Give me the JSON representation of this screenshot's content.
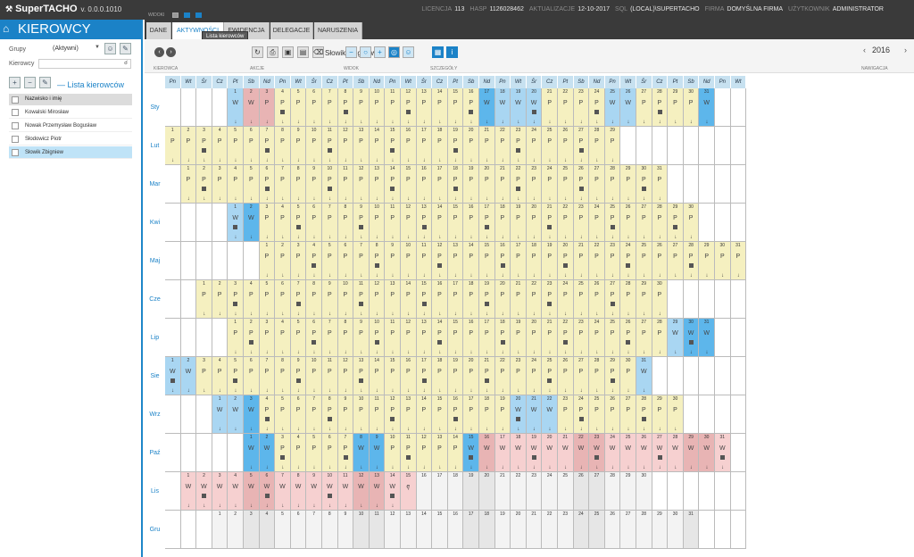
{
  "app": {
    "name": "SuperTACHO",
    "version": "v. 0.0.0.1010",
    "widok_label": "WIDOKI"
  },
  "status": [
    {
      "label": "LICENCJA",
      "value": "113"
    },
    {
      "label": "HASP",
      "value": "1126028462"
    },
    {
      "label": "AKTUALIZACJE",
      "value": "12-10-2017"
    },
    {
      "label": "SQL",
      "value": "(LOCAL)\\SUPERTACHO"
    },
    {
      "label": "FIRMA",
      "value": "DOMYŚLNA FIRMA"
    },
    {
      "label": "UŻYTKOWNIK",
      "value": "ADMINISTRATOR"
    }
  ],
  "left": {
    "title": "KIEROWCY",
    "groups_label": "Grupy",
    "groups_value": "(Aktywni)",
    "drivers_label": "Kierowcy",
    "list_title": "Lista kierowców",
    "column_header": "Nazwisko i imię",
    "drivers": [
      "Kowalski Mirosław",
      "Nowak Przemysław Bogusław",
      "Słodowicz Piotr",
      "Słowik Zbigniew"
    ],
    "selected_index": 3
  },
  "tabs": [
    "DANE",
    "AKTYWNOŚCI",
    "EWIDENCJA",
    "DELEGACJE",
    "NARUSZENIA"
  ],
  "active_tab": 1,
  "tooltip": "Lista kierowców",
  "toolbar": {
    "driver_name": "Słowik Zbigniew",
    "groups": [
      "KIEROWCA",
      "AKCJE",
      "WIDOK",
      "SZCZEGÓŁY",
      "NAWIGACJA"
    ],
    "year": "2016",
    "icons": {
      "prev": "chevron-left-icon",
      "next": "chevron-right-icon",
      "refresh": "refresh-icon",
      "print": "print-icon",
      "save": "save-icon",
      "export": "export-icon",
      "delete": "trash-icon"
    }
  },
  "calendar": {
    "weekdays": [
      "Pn",
      "Wt",
      "Śr",
      "Cz",
      "Pt",
      "Sb",
      "Nd"
    ],
    "months": [
      "Sty",
      "Lut",
      "Mar",
      "Kwi",
      "Maj",
      "Cze",
      "Lip",
      "Sie",
      "Wrz",
      "Paź",
      "Lis",
      "Gru"
    ],
    "month_start": [
      4,
      0,
      1,
      4,
      6,
      2,
      4,
      0,
      3,
      5,
      1,
      3
    ],
    "month_days": [
      31,
      29,
      31,
      30,
      31,
      30,
      31,
      31,
      30,
      31,
      30,
      31
    ],
    "rows": [
      "WWPPPPPPPPPPPPPPWWWWPPPPWWPPPPW",
      "PPPPPPPPPPPPPPPPPPPPPPPPPPPPP",
      "PPPPPPPPPPPPPPPPPPPPPPPPPPPPPPP",
      "WWPPPPPPPPPPPPPPPPPPPPPPPPPPPPW",
      "PPPPPPPPPPPPPPPPPPPPPPPPPPPPPPP",
      "PPPPPPPPPPPPPPPPPPPPPPPPPPPPPP",
      "PPPPPPPPPPPPPPPPPPPPPPPPPPPPWWW",
      "WWPPPPPPPPPPPPPPPPPPPPPPPPPPPPW",
      "WWWPPPPPPPPPPPPPPPPWWWPPPPPPPPP",
      "WWPPPPPWWPPPPPWWWWWWWWWWWWWWWWW",
      "WWWWWWWWWWWWWWZ---------------",
      "-------------------------------"
    ]
  }
}
